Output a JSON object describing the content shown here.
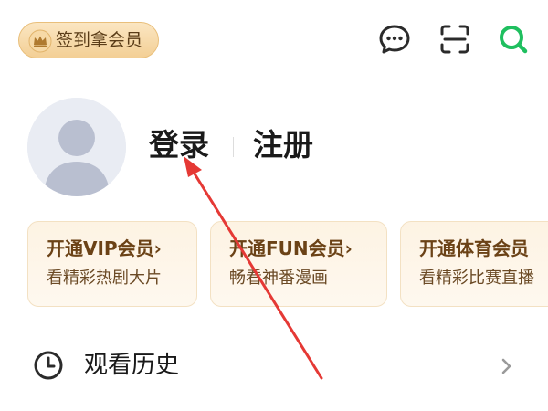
{
  "header": {
    "signin_badge": "签到拿会员",
    "icons": [
      "message-icon",
      "scan-icon",
      "search-icon"
    ],
    "accent_color": "#1fbf5f"
  },
  "profile": {
    "login": "登录",
    "register": "注册"
  },
  "membership_cards": [
    {
      "title": "开通VIP会员",
      "chevron": "›",
      "subtitle": "看精彩热剧大片"
    },
    {
      "title": "开通FUN会员",
      "chevron": "›",
      "subtitle": "畅看神番漫画"
    },
    {
      "title": "开通体育会员",
      "chevron": "",
      "subtitle": "看精彩比赛直播"
    }
  ],
  "menu": {
    "history": {
      "label": "观看历史",
      "chevron": "›"
    }
  },
  "colors": {
    "card_title": "#6b4216",
    "badge_bg": "#f3cf95",
    "annotation_arrow": "#e53935"
  }
}
